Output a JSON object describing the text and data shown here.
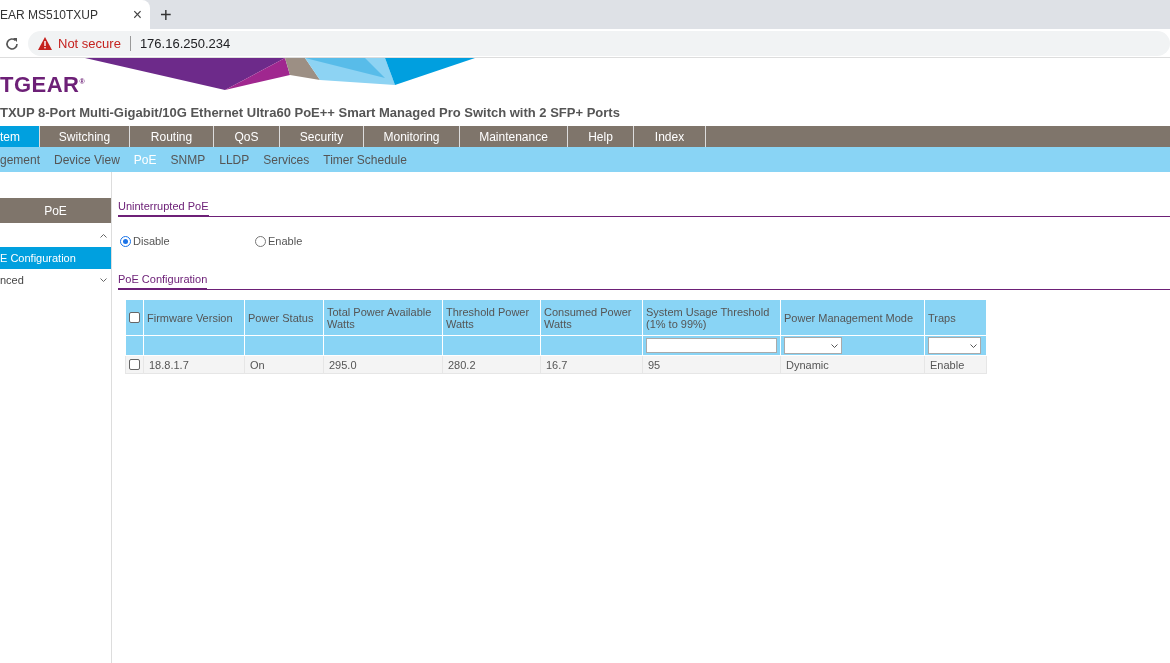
{
  "browser": {
    "tab_title": "EAR MS510TXUP",
    "close": "×",
    "new_tab": "+",
    "security": "Not secure",
    "url": "176.16.250.234"
  },
  "header": {
    "logo": "TGEAR$^{®}$",
    "title": "TXUP 8-Port Multi-Gigabit/10G Ethernet Ultra60 PoE++ Smart Managed Pro Switch with 2 SFP+ Ports"
  },
  "main_nav": [
    {
      "label": "tem",
      "selected": true
    },
    {
      "label": "Switching",
      "selected": false
    },
    {
      "label": "Routing",
      "selected": false
    },
    {
      "label": "QoS",
      "selected": false
    },
    {
      "label": "Security",
      "selected": false
    },
    {
      "label": "Monitoring",
      "selected": false
    },
    {
      "label": "Maintenance",
      "selected": false
    },
    {
      "label": "Help",
      "selected": false
    },
    {
      "label": "Index",
      "selected": false
    }
  ],
  "sub_nav": [
    {
      "label": "gement",
      "selected": false
    },
    {
      "label": "Device View",
      "selected": false
    },
    {
      "label": "PoE",
      "selected": true
    },
    {
      "label": "SNMP",
      "selected": false
    },
    {
      "label": "LLDP",
      "selected": false
    },
    {
      "label": "Services",
      "selected": false
    },
    {
      "label": "Timer Schedule",
      "selected": false
    }
  ],
  "sidebar": {
    "title": "PoE",
    "items": [
      {
        "expanded": true,
        "children": [
          {
            "label": "E Configuration",
            "selected": true
          }
        ]
      },
      {
        "label": "nced",
        "expanded": false
      }
    ]
  },
  "uninterrupted_poe": {
    "title": "Uninterrupted PoE",
    "options": [
      {
        "label": "Disable",
        "selected": true
      },
      {
        "label": "Enable",
        "selected": false
      }
    ]
  },
  "poe_configuration": {
    "title": "PoE Configuration",
    "header_checked": false,
    "columns": [
      {
        "label": "Firmware Version"
      },
      {
        "label": "Power Status"
      },
      {
        "label": "Total Power Available Watts"
      },
      {
        "label": "Threshold Power Watts"
      },
      {
        "label": "Consumed Power Watts"
      },
      {
        "label": "System Usage Threshold (1% to 99%)",
        "kind": "text"
      },
      {
        "label": "Power Management Mode",
        "kind": "select"
      },
      {
        "label": "Traps",
        "kind": "select"
      }
    ],
    "rows": [
      {
        "checked": false,
        "cells": [
          "18.8.1.7",
          "On",
          "295.0",
          "280.2",
          "16.7",
          "95",
          "Dynamic",
          "Enable"
        ]
      }
    ]
  }
}
